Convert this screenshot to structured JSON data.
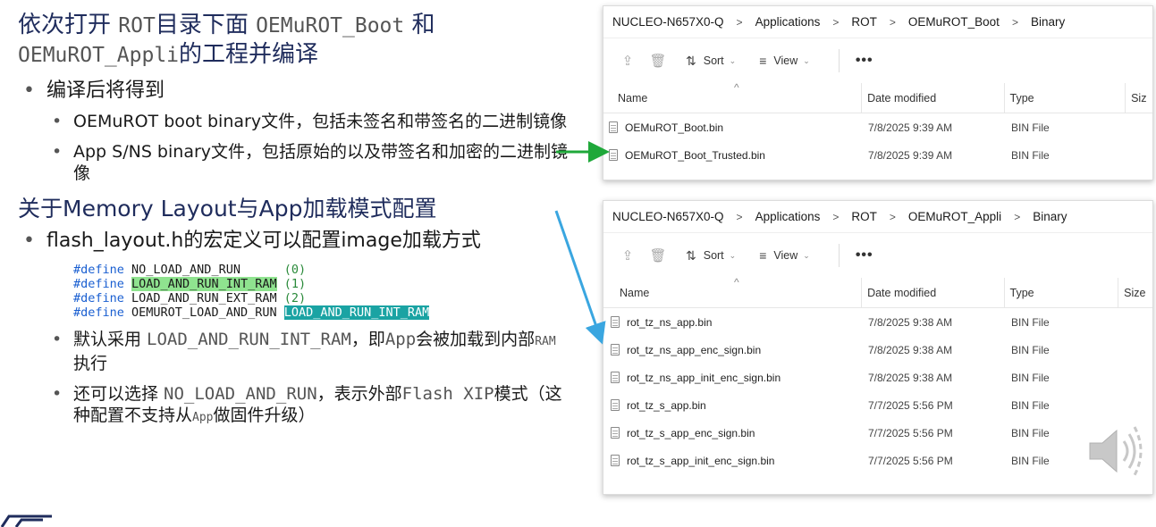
{
  "slide": {
    "heading1": {
      "text_a": "依次打开 ",
      "mono_a": "ROT",
      "text_b": "目录下面 ",
      "mono_b": "OEMuROT_Boot",
      "text_c": " 和",
      "mono_c": "OEMuROT_Appli",
      "text_d": "的工程并编译"
    },
    "bullet_compile": "编译后将得到",
    "sub_boot": "OEMuROT boot binary文件，包括未签名和带签名的二进制镜像",
    "sub_app": "App S/NS binary文件，包括原始的以及带签名和加密的二进制镜像",
    "heading2": "关于Memory Layout与App加载模式配置",
    "bullet_flash": "flash_layout.h的宏定义可以配置image加载方式",
    "code": [
      {
        "kw": "#define",
        "name": " NO_LOAD_AND_RUN      ",
        "val": "(0)"
      },
      {
        "kw": "#define",
        "name": "LOAD_AND_RUN_INT_RAM",
        "val": " (1)"
      },
      {
        "kw": "#define",
        "name": " LOAD_AND_RUN_EXT_RAM ",
        "val": "(2)"
      },
      {
        "kw": "#define",
        "name": " OEMUROT_LOAD_AND_RUN ",
        "val": "LOAD_AND_RUN_INT_RAM"
      }
    ],
    "sub_default": {
      "a": "默认采用 ",
      "mono": "LOAD_AND_RUN_INT_RAM",
      "b": "，即",
      "mono2": "App",
      "c": "会被加载到内部",
      "mono3": "RAM",
      "d": "执行"
    },
    "sub_option": {
      "a": "还可以选择 ",
      "mono": "NO_LOAD_AND_RUN",
      "b": "，表示外部",
      "mono2": "Flash XIP",
      "c": "模式（这种配置不支持从",
      "mono3": "App",
      "d": "做固件升级）"
    }
  },
  "explorer_boot": {
    "breadcrumb": [
      "NUCLEO-N657X0-Q",
      "Applications",
      "ROT",
      "OEMuROT_Boot",
      "Binary"
    ],
    "toolbar": {
      "sort": "Sort",
      "view": "View",
      "more": "•••"
    },
    "columns": [
      "Name",
      "Date modified",
      "Type",
      "Siz"
    ],
    "files": [
      {
        "name": "OEMuROT_Boot.bin",
        "date": "7/8/2025 9:39 AM",
        "type": "BIN File"
      },
      {
        "name": "OEMuROT_Boot_Trusted.bin",
        "date": "7/8/2025 9:39 AM",
        "type": "BIN File"
      }
    ]
  },
  "explorer_appli": {
    "breadcrumb": [
      "NUCLEO-N657X0-Q",
      "Applications",
      "ROT",
      "OEMuROT_Appli",
      "Binary"
    ],
    "toolbar": {
      "sort": "Sort",
      "view": "View",
      "more": "•••"
    },
    "columns": [
      "Name",
      "Date modified",
      "Type",
      "Size"
    ],
    "files": [
      {
        "name": "rot_tz_ns_app.bin",
        "date": "7/8/2025 9:38 AM",
        "type": "BIN File"
      },
      {
        "name": "rot_tz_ns_app_enc_sign.bin",
        "date": "7/8/2025 9:38 AM",
        "type": "BIN File"
      },
      {
        "name": "rot_tz_ns_app_init_enc_sign.bin",
        "date": "7/8/2025 9:38 AM",
        "type": "BIN File"
      },
      {
        "name": "rot_tz_s_app.bin",
        "date": "7/7/2025 5:56 PM",
        "type": "BIN File"
      },
      {
        "name": "rot_tz_s_app_enc_sign.bin",
        "date": "7/7/2025 5:56 PM",
        "type": "BIN File"
      },
      {
        "name": "rot_tz_s_app_init_enc_sign.bin",
        "date": "7/7/2025 5:56 PM",
        "type": "BIN File"
      }
    ]
  },
  "colors": {
    "arrow_green": "#1fa83a",
    "arrow_blue": "#3aa6e0",
    "highlight_green": "#8fe38f",
    "highlight_teal": "#1aa3a3"
  },
  "icons": [
    "share-icon",
    "delete-icon",
    "sort-icon",
    "view-icon",
    "file-icon",
    "speaker-icon"
  ]
}
